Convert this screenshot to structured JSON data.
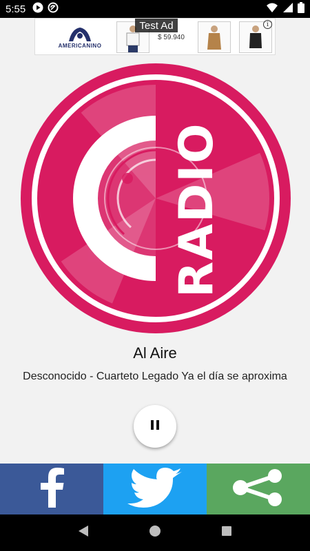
{
  "status_bar": {
    "time": "5:55"
  },
  "ad": {
    "label": "Test Ad",
    "brand": "AMERICANINO",
    "price": "$ 59.940",
    "info_glyph": "i"
  },
  "station": {
    "logo_text": "RADIO",
    "logo_color": "#d81b60"
  },
  "player": {
    "title": "Al Aire",
    "track": "Desconocido - Cuarteto Legado Ya el día se aproxima",
    "state": "playing"
  },
  "share": {
    "facebook_color": "#3b5998",
    "twitter_color": "#1da1f2",
    "share_color": "#5aa75f"
  },
  "colors": {
    "background": "#f2f2f2"
  }
}
